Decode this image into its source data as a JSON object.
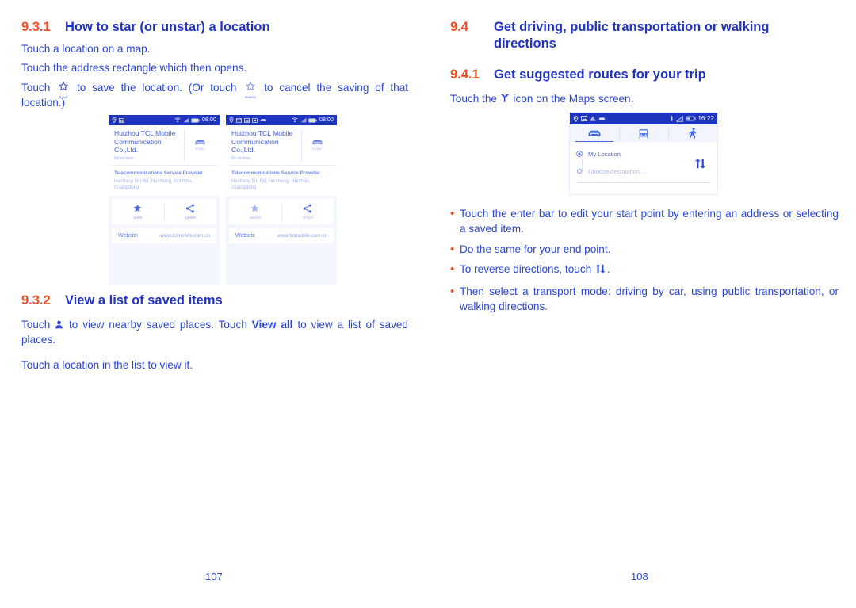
{
  "document": {
    "left_page_number": "107",
    "right_page_number": "108"
  },
  "colors": {
    "section_number": "#F04E23",
    "heading": "#2033C4",
    "body": "#2B46D4",
    "status_bar": "#1D35BE",
    "accent_ui": "#4A6BE2"
  },
  "left_column": {
    "section_9_3_1": {
      "number": "9.3.1",
      "title": "How to star (or unstar) a location",
      "paragraphs": [
        "Touch a location on a map.",
        "Touch the address rectangle which then opens."
      ],
      "star_instruction": {
        "prefix": "Touch",
        "save_icon_caption": "Save",
        "middle": "to save the location. (Or touch",
        "saved_icon_caption": "Saved",
        "suffix": "to cancel the saving of that location.)"
      }
    },
    "section_9_3_2": {
      "number": "9.3.2",
      "title": "View a list of saved items",
      "instruction": {
        "prefix": "Touch",
        "person_icon": "person-icon",
        "middle": "to view nearby saved places. Touch",
        "bold_link": "View all",
        "suffix": "to view a list of saved places."
      },
      "paragraph": "Touch a location in the list to view it."
    },
    "screenshot_save": {
      "status_bar": {
        "time": "08:00",
        "left_icons": [
          "location-icon",
          "picture-icon"
        ],
        "right_icons": [
          "wifi-icon",
          "signal-icon",
          "battery-icon"
        ]
      },
      "place_name": "Huizhou TCL Mobile Communication Co.,Ltd.",
      "reviews": "No reviews",
      "drive_time": "4 min",
      "category": "Telecommunications Service Provider",
      "address": "Hechang 5th Rd, Huicheng, Huizhou, Guangdong",
      "actions": [
        {
          "icon": "star-icon",
          "label": "Save",
          "state": "inactive"
        },
        {
          "icon": "share-icon",
          "label": "Share",
          "state": "inactive"
        }
      ],
      "website_label": "Website",
      "website_url": "www.tclmobile.com.cn"
    },
    "screenshot_saved": {
      "status_bar": {
        "time": "08:00",
        "left_icons": [
          "location-icon",
          "mail-icon",
          "picture-icon",
          "sim-icon",
          "car-icon"
        ],
        "right_icons": [
          "wifi-icon",
          "signal-icon",
          "battery-icon"
        ]
      },
      "place_name": "Huizhou TCL Mobile Communication Co.,Ltd.",
      "reviews": "No reviews",
      "drive_time": "4 min",
      "category": "Telecommunications Service Provider",
      "address": "Hechang 5th Rd, Huicheng, Huizhou, Guangdong",
      "actions": [
        {
          "icon": "star-icon",
          "label": "Saved",
          "state": "active"
        },
        {
          "icon": "share-icon",
          "label": "Share",
          "state": "inactive"
        }
      ],
      "website_label": "Website",
      "website_url": "www.tclmobile.com.cn"
    }
  },
  "right_column": {
    "section_9_4": {
      "number": "9.4",
      "title": "Get driving, public transportation or walking directions"
    },
    "section_9_4_1": {
      "number": "9.4.1",
      "title": "Get suggested routes for your trip",
      "instruction": {
        "prefix": "Touch the",
        "icon": "directions-icon",
        "suffix": "icon on the Maps screen."
      }
    },
    "bullets": [
      {
        "text": "Touch the enter bar to edit your start point by entering an address or selecting a saved item."
      },
      {
        "text": "Do the same for your end point."
      },
      {
        "text_prefix": "To reverse directions, touch",
        "icon": "swap-arrows-icon",
        "text_suffix": "."
      },
      {
        "text": "Then select a transport mode: driving by car, using public transportation, or walking directions."
      }
    ],
    "screenshot_directions": {
      "status_bar": {
        "time": "16:22",
        "left_icons": [
          "location-icon",
          "picture-icon",
          "warning-icon",
          "car-icon"
        ],
        "right_icons": [
          "usb-icon",
          "silent-icon",
          "battery-icon"
        ]
      },
      "tabs": [
        {
          "icon": "car-icon",
          "label": "Driving",
          "selected": true
        },
        {
          "icon": "transit-icon",
          "label": "Transit",
          "selected": false
        },
        {
          "icon": "walking-icon",
          "label": "Walking",
          "selected": false
        }
      ],
      "start_point": "My Location",
      "end_point_placeholder": "Choose destination...",
      "swap_button": "swap-arrows-icon"
    }
  }
}
